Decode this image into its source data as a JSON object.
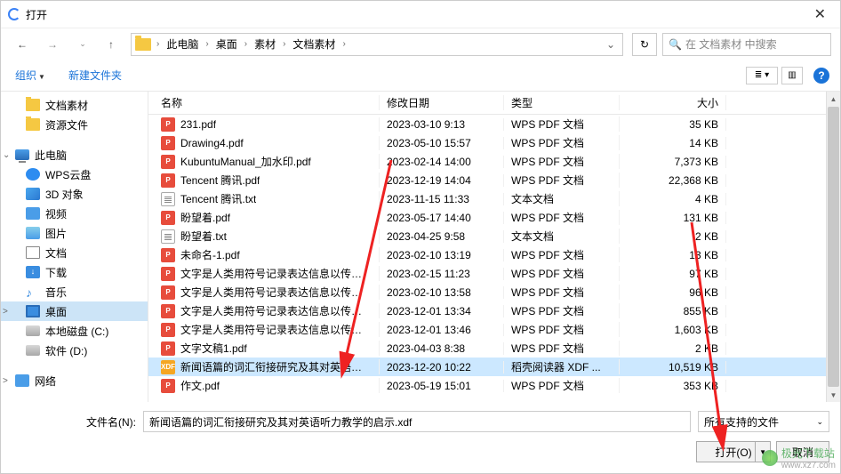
{
  "title": "打开",
  "breadcrumb": {
    "items": [
      "此电脑",
      "桌面",
      "素材",
      "文档素材"
    ]
  },
  "search": {
    "placeholder": "在 文档素材 中搜索"
  },
  "toolbar": {
    "organize": "组织",
    "newfolder": "新建文件夹"
  },
  "sidebar": {
    "items": [
      {
        "label": "文档素材",
        "icon": "folder",
        "level": 2
      },
      {
        "label": "资源文件",
        "icon": "folder",
        "level": 2
      },
      {
        "label": "",
        "spacer": true
      },
      {
        "label": "此电脑",
        "icon": "pc",
        "level": 1,
        "exp": "⌄"
      },
      {
        "label": "WPS云盘",
        "icon": "cloud",
        "level": 2
      },
      {
        "label": "3D 对象",
        "icon": "cube",
        "level": 2
      },
      {
        "label": "视频",
        "icon": "video",
        "level": 2
      },
      {
        "label": "图片",
        "icon": "pic",
        "level": 2
      },
      {
        "label": "文档",
        "icon": "doc",
        "level": 2
      },
      {
        "label": "下载",
        "icon": "dl",
        "level": 2
      },
      {
        "label": "音乐",
        "icon": "music",
        "level": 2
      },
      {
        "label": "桌面",
        "icon": "desk",
        "level": 2,
        "sel": true,
        "exp": ">"
      },
      {
        "label": "本地磁盘 (C:)",
        "icon": "disk",
        "level": 2
      },
      {
        "label": "软件 (D:)",
        "icon": "disk",
        "level": 2
      },
      {
        "label": "",
        "spacer": true
      },
      {
        "label": "网络",
        "icon": "net",
        "level": 1,
        "exp": ">"
      }
    ]
  },
  "columns": {
    "name": "名称",
    "date": "修改日期",
    "type": "类型",
    "size": "大小"
  },
  "files": [
    {
      "name": "231.pdf",
      "date": "2023-03-10 9:13",
      "type": "WPS PDF 文档",
      "size": "35 KB",
      "ico": "pdf"
    },
    {
      "name": "Drawing4.pdf",
      "date": "2023-05-10 15:57",
      "type": "WPS PDF 文档",
      "size": "14 KB",
      "ico": "pdf"
    },
    {
      "name": "KubuntuManual_加水印.pdf",
      "date": "2023-02-14 14:00",
      "type": "WPS PDF 文档",
      "size": "7,373 KB",
      "ico": "pdf"
    },
    {
      "name": "Tencent 腾讯.pdf",
      "date": "2023-12-19 14:04",
      "type": "WPS PDF 文档",
      "size": "22,368 KB",
      "ico": "pdf"
    },
    {
      "name": "Tencent 腾讯.txt",
      "date": "2023-11-15 11:33",
      "type": "文本文档",
      "size": "4 KB",
      "ico": "txt"
    },
    {
      "name": "盼望着.pdf",
      "date": "2023-05-17 14:40",
      "type": "WPS PDF 文档",
      "size": "131 KB",
      "ico": "pdf"
    },
    {
      "name": "盼望着.txt",
      "date": "2023-04-25 9:58",
      "type": "文本文档",
      "size": "2 KB",
      "ico": "txt"
    },
    {
      "name": "未命名-1.pdf",
      "date": "2023-02-10 13:19",
      "type": "WPS PDF 文档",
      "size": "13 KB",
      "ico": "pdf"
    },
    {
      "name": "文字是人类用符号记录表达信息以传之久...",
      "date": "2023-02-15 11:23",
      "type": "WPS PDF 文档",
      "size": "97 KB",
      "ico": "pdf"
    },
    {
      "name": "文字是人类用符号记录表达信息以传之久...",
      "date": "2023-02-10 13:58",
      "type": "WPS PDF 文档",
      "size": "96 KB",
      "ico": "pdf"
    },
    {
      "name": "文字是人类用符号记录表达信息以传之久...",
      "date": "2023-12-01 13:34",
      "type": "WPS PDF 文档",
      "size": "855 KB",
      "ico": "pdf"
    },
    {
      "name": "文字是人类用符号记录表达信息以传之久...",
      "date": "2023-12-01 13:46",
      "type": "WPS PDF 文档",
      "size": "1,603 KB",
      "ico": "pdf"
    },
    {
      "name": "文字文稿1.pdf",
      "date": "2023-04-03 8:38",
      "type": "WPS PDF 文档",
      "size": "2 KB",
      "ico": "pdf"
    },
    {
      "name": "新闻语篇的词汇衔接研究及其对英语听力...",
      "date": "2023-12-20 10:22",
      "type": "稻壳阅读器 XDF ...",
      "size": "10,519 KB",
      "ico": "xdf",
      "sel": true
    },
    {
      "name": "作文.pdf",
      "date": "2023-05-19 15:01",
      "type": "WPS PDF 文档",
      "size": "353 KB",
      "ico": "pdf"
    }
  ],
  "filename": {
    "label": "文件名(N):",
    "value": "新闻语篇的词汇衔接研究及其对英语听力教学的启示.xdf"
  },
  "filter": {
    "label": "所有支持的文件"
  },
  "buttons": {
    "open": "打开(O)",
    "cancel": "取消"
  },
  "watermark": {
    "text": "极光下载站",
    "url": "www.xz7.com"
  }
}
